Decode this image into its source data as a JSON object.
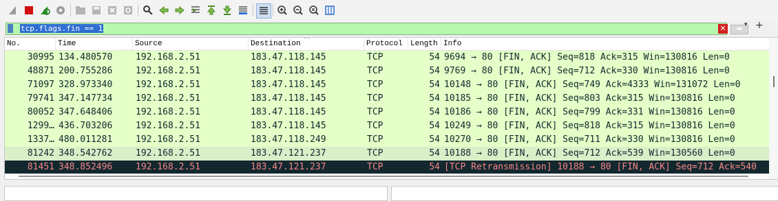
{
  "toolbar": {
    "icons": [
      "shark-fin-start-icon",
      "stop-icon",
      "restart-icon",
      "capture-options-icon",
      "open-file-icon",
      "save-file-icon",
      "close-file-icon",
      "reload-icon",
      "find-icon",
      "go-back-icon",
      "go-forward-icon",
      "go-to-packet-icon",
      "first-packet-icon",
      "last-packet-icon",
      "autoscroll-icon",
      "colorize-icon",
      "zoom-in-icon",
      "zoom-out-icon",
      "zoom-normal-icon",
      "resize-columns-icon"
    ]
  },
  "filter": {
    "value": "tcp.flags.fin == 1"
  },
  "columns": [
    "No.",
    "Time",
    "Source",
    "Destination",
    "Protocol",
    "Length",
    "Info"
  ],
  "packets": [
    {
      "no": "30995",
      "time": "134.480570",
      "src": "192.168.2.51",
      "dst": "183.47.118.145",
      "proto": "TCP",
      "len": "54",
      "info": "9694 → 80 [FIN, ACK] Seq=818 Ack=315 Win=130816 Len=0"
    },
    {
      "no": "48871",
      "time": "200.755286",
      "src": "192.168.2.51",
      "dst": "183.47.118.145",
      "proto": "TCP",
      "len": "54",
      "info": "9769 → 80 [FIN, ACK] Seq=712 Ack=330 Win=130816 Len=0"
    },
    {
      "no": "71097",
      "time": "328.973340",
      "src": "192.168.2.51",
      "dst": "183.47.118.145",
      "proto": "TCP",
      "len": "54",
      "info": "10148 → 80 [FIN, ACK] Seq=749 Ack=4333 Win=131072 Len=0"
    },
    {
      "no": "79741",
      "time": "347.147734",
      "src": "192.168.2.51",
      "dst": "183.47.118.145",
      "proto": "TCP",
      "len": "54",
      "info": "10185 → 80 [FIN, ACK] Seq=803 Ack=315 Win=130816 Len=0"
    },
    {
      "no": "80052",
      "time": "347.648406",
      "src": "192.168.2.51",
      "dst": "183.47.118.145",
      "proto": "TCP",
      "len": "54",
      "info": "10186 → 80 [FIN, ACK] Seq=799 Ack=331 Win=130816 Len=0"
    },
    {
      "no": "1299…",
      "time": "436.703206",
      "src": "192.168.2.51",
      "dst": "183.47.118.145",
      "proto": "TCP",
      "len": "54",
      "info": "10249 → 80 [FIN, ACK] Seq=818 Ack=315 Win=130816 Len=0"
    },
    {
      "no": "1337…",
      "time": "480.011281",
      "src": "192.168.2.51",
      "dst": "183.47.118.249",
      "proto": "TCP",
      "len": "54",
      "info": "10270 → 80 [FIN, ACK] Seq=711 Ack=330 Win=130816 Len=0"
    },
    {
      "no": "81242",
      "time": "348.542762",
      "src": "192.168.2.51",
      "dst": "183.47.121.237",
      "proto": "TCP",
      "len": "54",
      "info": "10188 → 80 [FIN, ACK] Seq=712 Ack=539 Win=130560 Len=0"
    },
    {
      "no": "81451",
      "time": "348.852496",
      "src": "192.168.2.51",
      "dst": "183.47.121.237",
      "proto": "TCP",
      "len": "54",
      "info": "[TCP Retransmission] 10188 → 80 [FIN, ACK] Seq=712 Ack=540"
    }
  ],
  "colors": {
    "row_green": "#e4ffc7",
    "row_green2": "#daeec8",
    "selected_bg": "#12272e",
    "selected_fg": "#f78787",
    "filter_bg": "#b8f7b0"
  }
}
